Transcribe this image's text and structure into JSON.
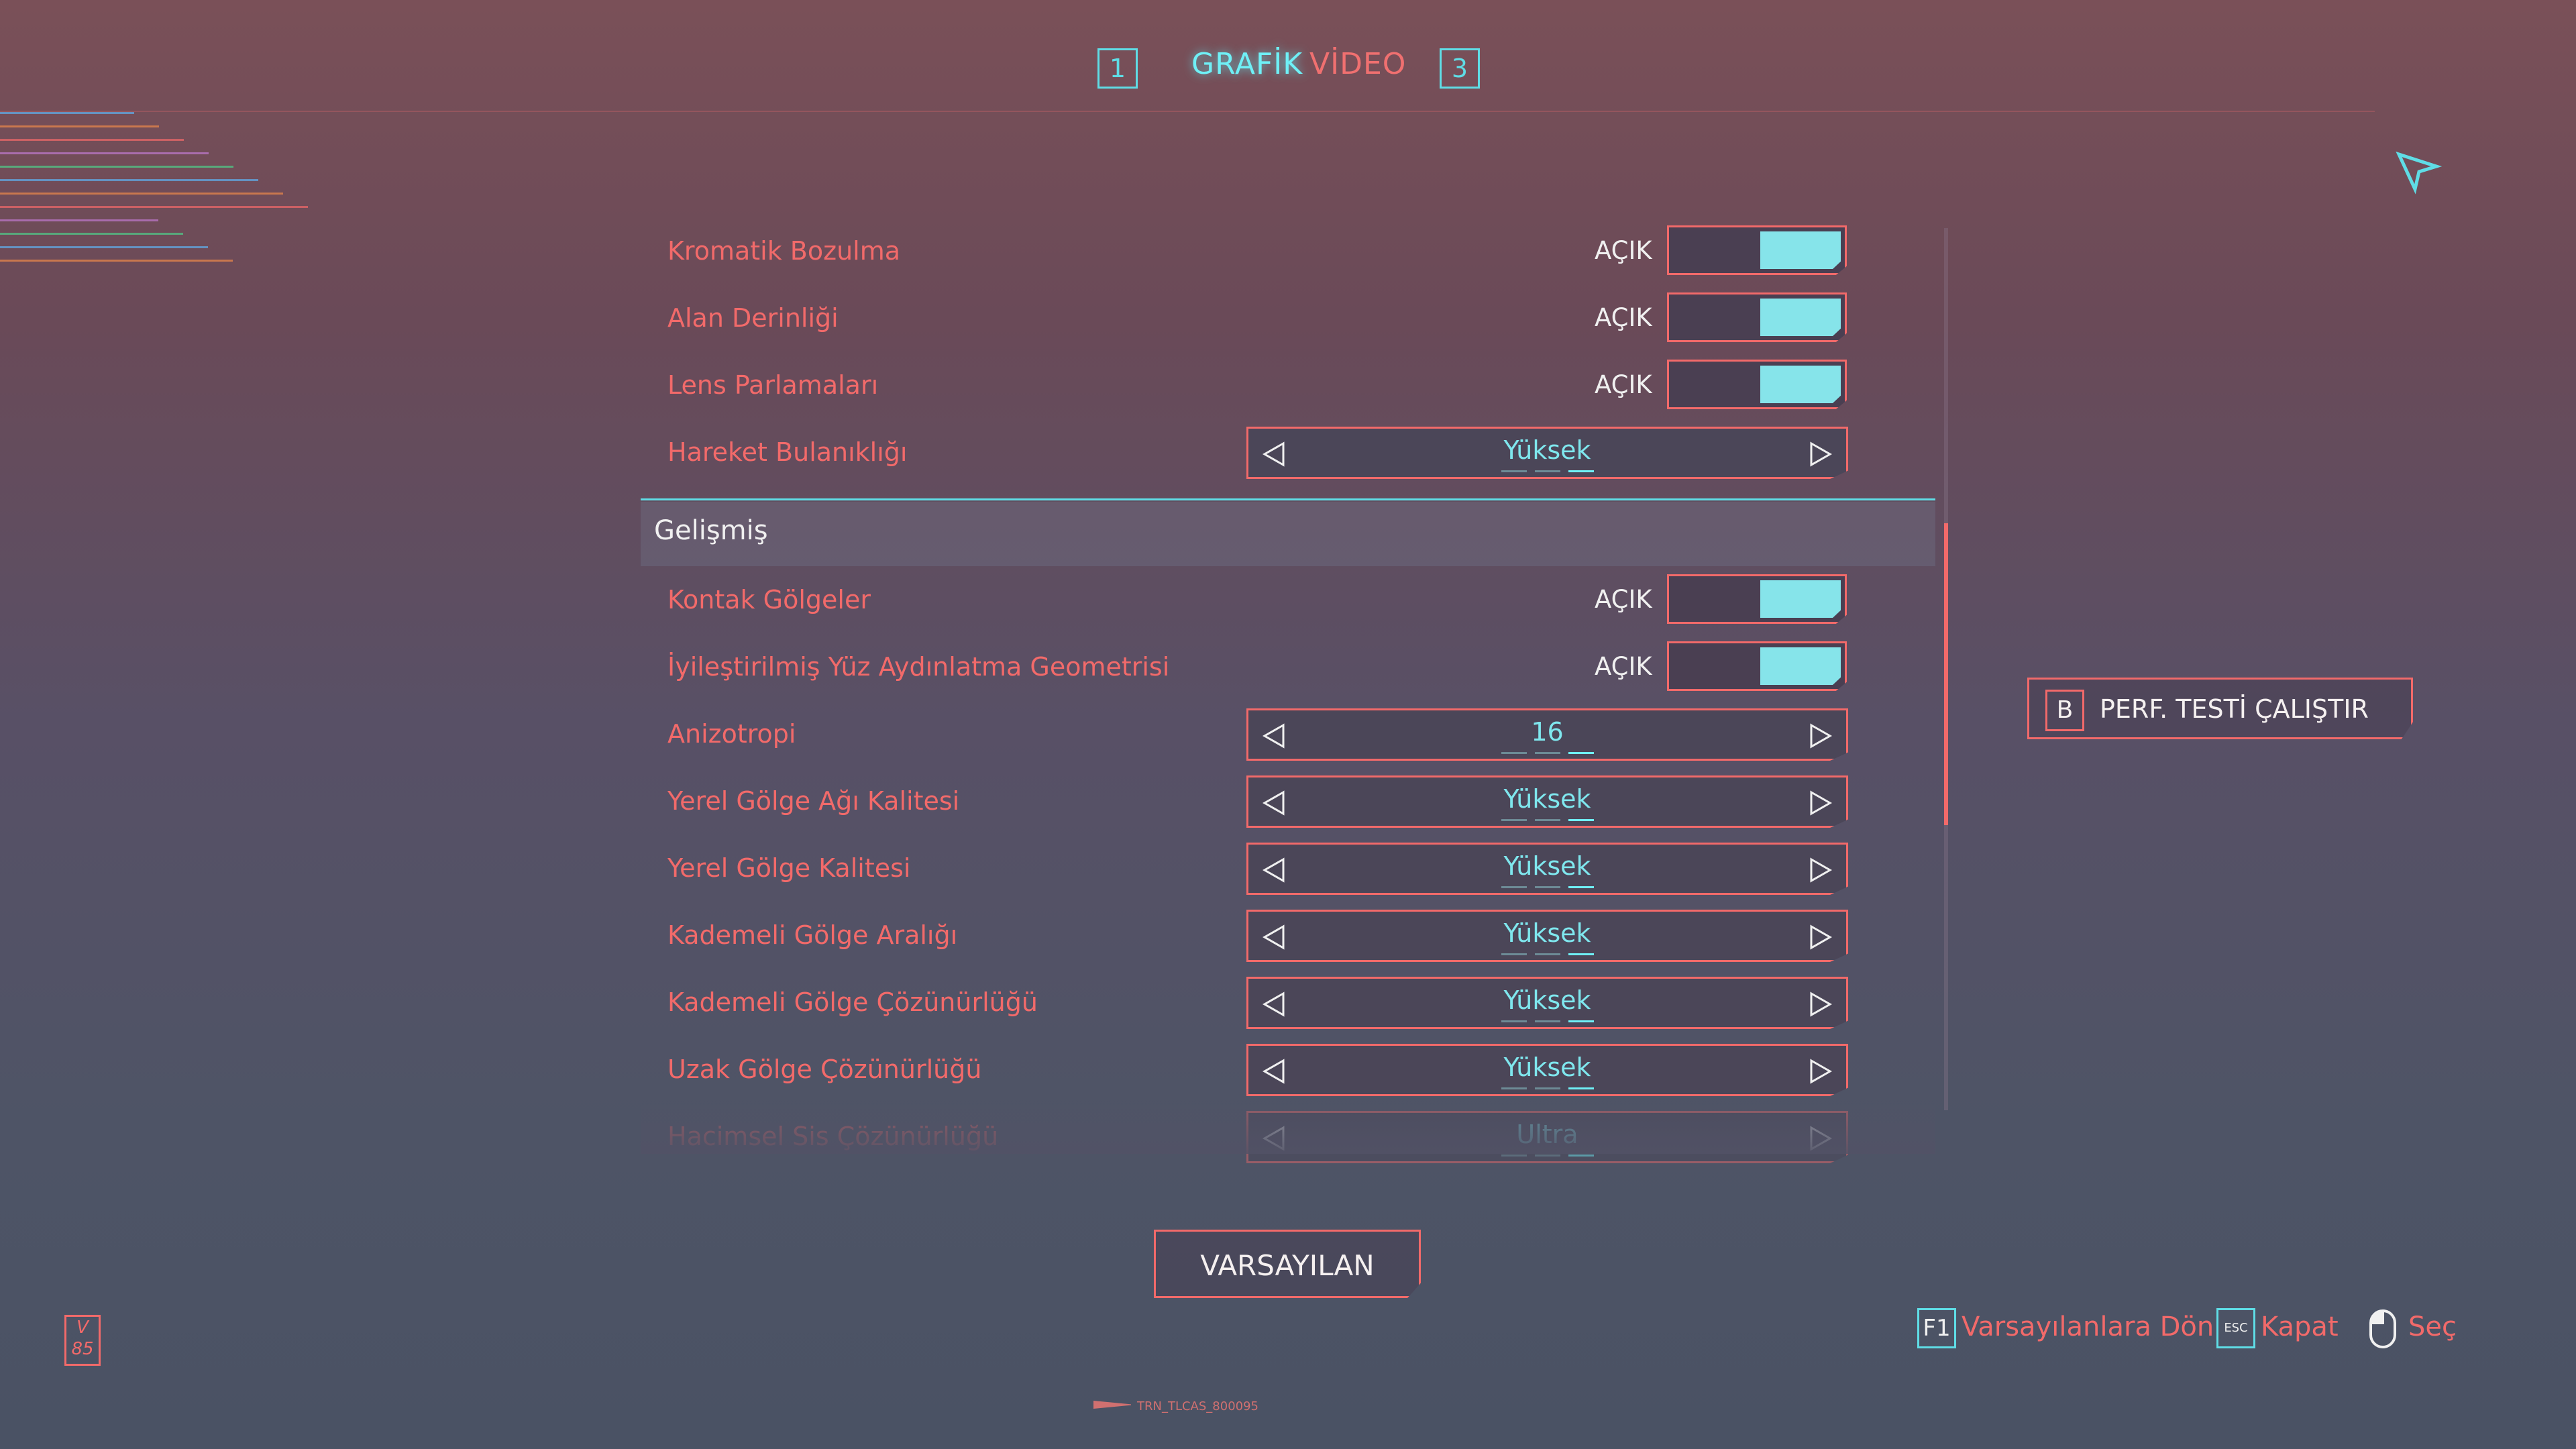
{
  "tabs": {
    "left_key": "1",
    "active": "GRAFİK",
    "inactive": "VİDEO",
    "right_key": "3"
  },
  "settings": [
    {
      "label": "Kromatik Bozulma",
      "kind": "toggle",
      "value": "AÇIK"
    },
    {
      "label": "Alan Derinliği",
      "kind": "toggle",
      "value": "AÇIK"
    },
    {
      "label": "Lens Parlamaları",
      "kind": "toggle",
      "value": "AÇIK"
    },
    {
      "label": "Hareket Bulanıklığı",
      "kind": "select",
      "value": "Yüksek"
    },
    {
      "label": "Kontak Gölgeler",
      "kind": "toggle",
      "value": "AÇIK"
    },
    {
      "label": "İyileştirilmiş Yüz Aydınlatma Geometrisi",
      "kind": "toggle",
      "value": "AÇIK"
    },
    {
      "label": "Anizotropi",
      "kind": "select",
      "value": "16"
    },
    {
      "label": "Yerel Gölge Ağı Kalitesi",
      "kind": "select",
      "value": "Yüksek"
    },
    {
      "label": "Yerel Gölge Kalitesi",
      "kind": "select",
      "value": "Yüksek"
    },
    {
      "label": "Kademeli Gölge Aralığı",
      "kind": "select",
      "value": "Yüksek"
    },
    {
      "label": "Kademeli Gölge Çözünürlüğü",
      "kind": "select",
      "value": "Yüksek"
    },
    {
      "label": "Uzak Gölge Çözünürlüğü",
      "kind": "select",
      "value": "Yüksek"
    },
    {
      "label": "Hacimsel Sis Çözünürlüğü",
      "kind": "select",
      "value": "Ultra"
    }
  ],
  "section": {
    "title": "Gelişmiş"
  },
  "perf_button": {
    "key": "B",
    "label": "PERF. TESTİ ÇALIŞTIR"
  },
  "default_button": {
    "label": "VARSAYILAN"
  },
  "hints": [
    {
      "key": "F1",
      "label": "Varsayılanlara Dön"
    },
    {
      "key": "ESC",
      "label": "Kapat"
    },
    {
      "key": "mouse",
      "label": "Seç"
    }
  ],
  "version": "V 85",
  "footer_code": "TRN_TLCAS_800095",
  "colors": {
    "accent_red": "#f26a6a",
    "accent_cyan": "#5fdde6",
    "toggle_fill": "#86e4ea"
  }
}
